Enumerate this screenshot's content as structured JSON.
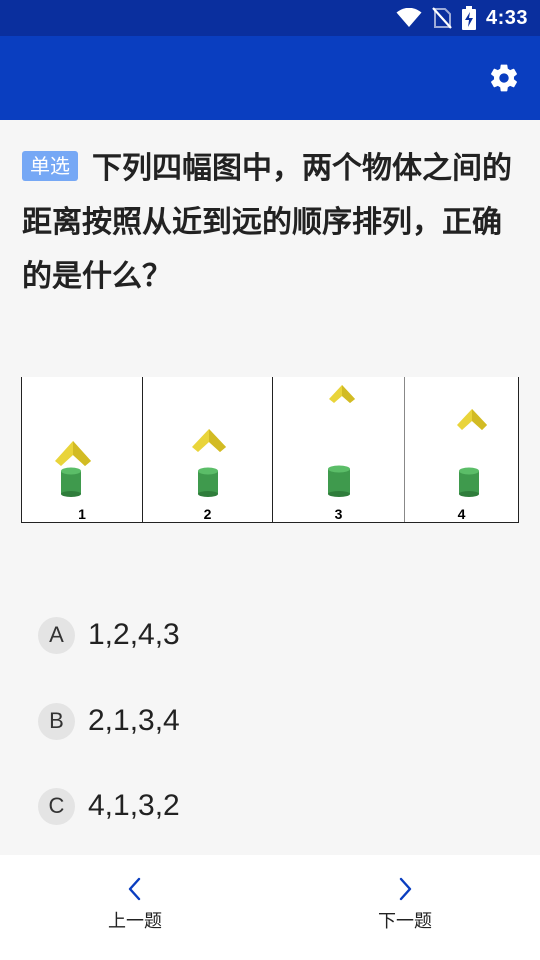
{
  "status_bar": {
    "time": "4:33",
    "icons": [
      "wifi-icon",
      "no-sim-icon",
      "battery-charging-icon"
    ]
  },
  "app_bar": {
    "icons": [
      "gear-icon"
    ],
    "accent": "#0a3ec0"
  },
  "question": {
    "type_label": "单选",
    "text": "下列四幅图中，两个物体之间的距离按照从近到远的顺序排列，正确的是什么？"
  },
  "figure": {
    "panels": [
      {
        "label": "1"
      },
      {
        "label": "2"
      },
      {
        "label": "3"
      },
      {
        "label": "4"
      }
    ]
  },
  "options": [
    {
      "letter": "A",
      "text": "1,2,4,3"
    },
    {
      "letter": "B",
      "text": "2,1,3,4"
    },
    {
      "letter": "C",
      "text": "4,1,3,2"
    }
  ],
  "navigation": {
    "prev_label": "上一题",
    "next_label": "下一题",
    "icons": [
      "chevron-left-icon",
      "chevron-right-icon"
    ]
  }
}
